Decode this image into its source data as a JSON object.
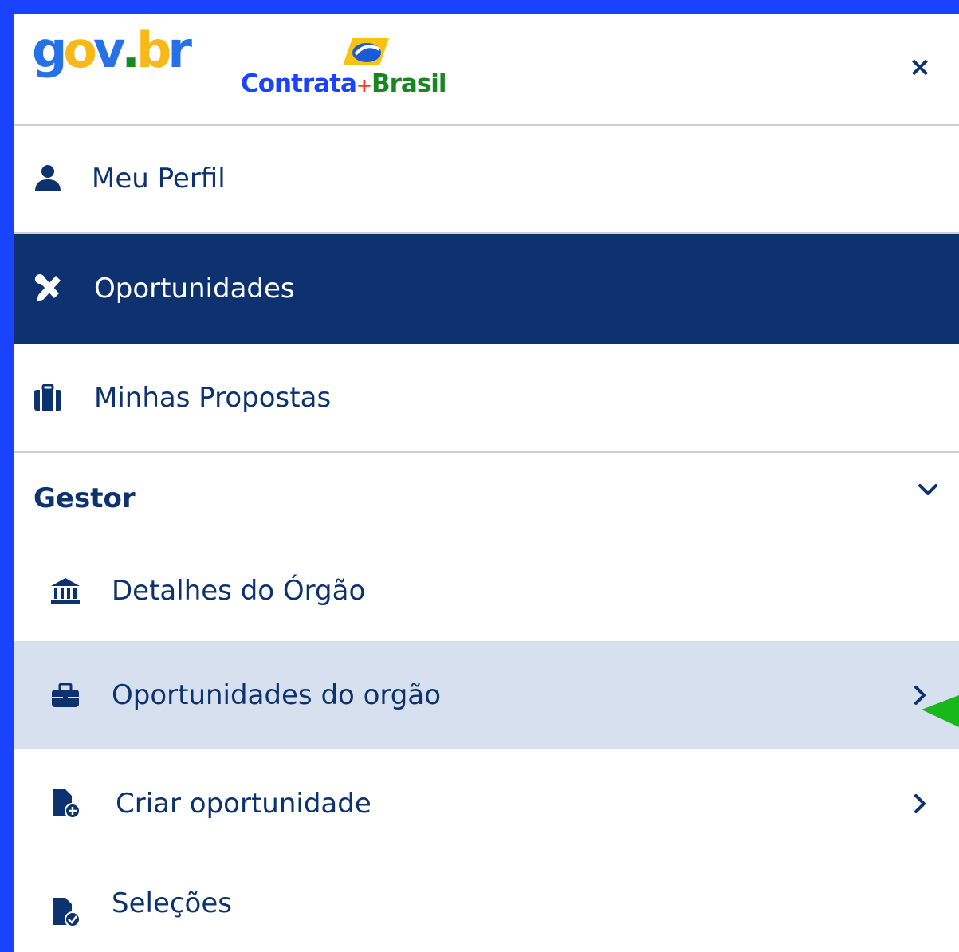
{
  "header": {
    "govbr_letters": [
      "g",
      "o",
      "v",
      ".",
      "b",
      "r"
    ],
    "contrata_logo": {
      "part1": "Contrata",
      "plus": "+",
      "part2": "Brasil"
    },
    "close_label": "×"
  },
  "menu": {
    "meu_perfil": "Meu Perfil",
    "oportunidades": "Oportunidades",
    "minhas_propostas": "Minhas Propostas"
  },
  "gestor": {
    "title": "Gestor",
    "items": [
      {
        "label": "Detalhes do Órgão",
        "icon": "bank-icon"
      },
      {
        "label": "Oportunidades do orgão",
        "icon": "toolbox-icon"
      },
      {
        "label": "Criar oportunidade",
        "icon": "file-plus-icon"
      },
      {
        "label": "Seleções",
        "icon": "file-check-icon"
      }
    ]
  },
  "colors": {
    "frame_border": "#1a43ff",
    "active_bg": "#0d326f",
    "hover_bg": "#d7e0ef",
    "text_primary": "#0c326f",
    "pointer_green": "#18b81a"
  }
}
